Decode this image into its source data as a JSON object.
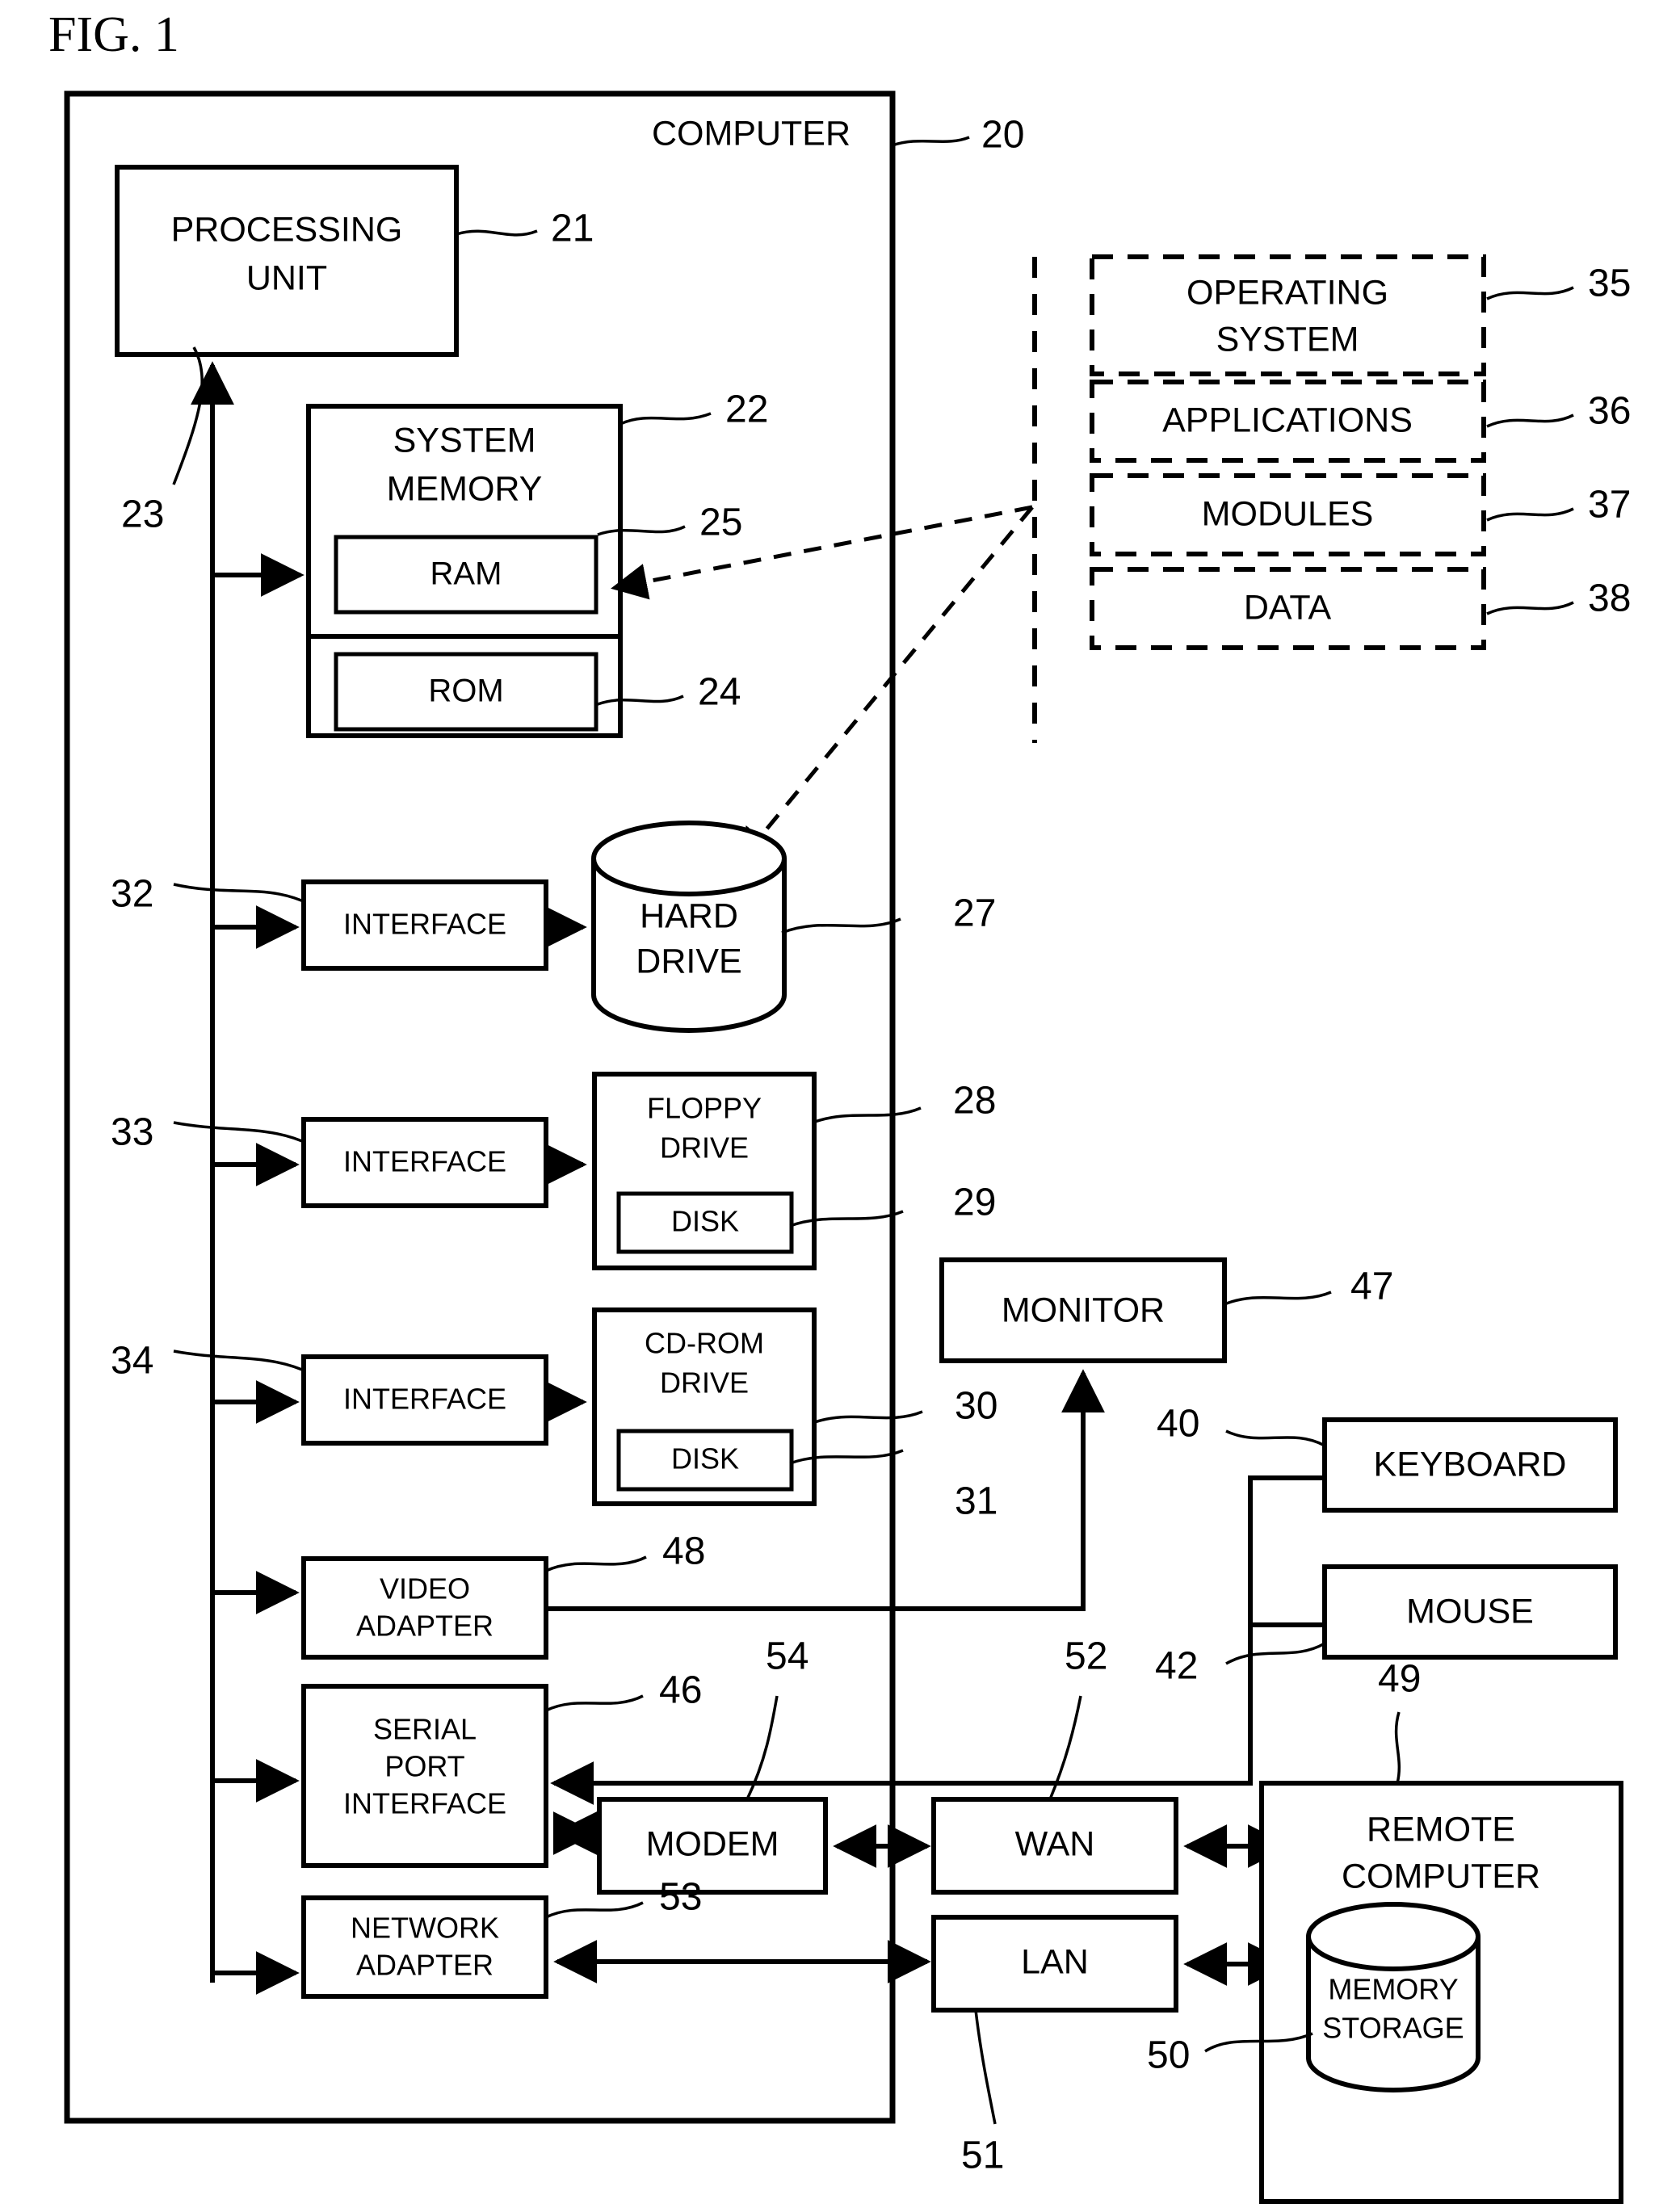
{
  "figure": {
    "title": "FIG. 1",
    "type": "patent-block-diagram"
  },
  "outer": {
    "computer_label": "COMPUTER",
    "computer_ref": "20"
  },
  "blocks": {
    "processing_unit": {
      "line1": "PROCESSING",
      "line2": "UNIT",
      "ref": "21"
    },
    "system_memory": {
      "line1": "SYSTEM",
      "line2": "MEMORY",
      "ref": "22"
    },
    "ram": {
      "label": "RAM",
      "ref": "25"
    },
    "rom": {
      "label": "ROM",
      "ref": "24"
    },
    "bus": {
      "ref": "23"
    },
    "interface_hdd": {
      "label": "INTERFACE",
      "ref": "32"
    },
    "interface_fdd": {
      "label": "INTERFACE",
      "ref": "33"
    },
    "interface_cdrom": {
      "label": "INTERFACE",
      "ref": "34"
    },
    "hard_drive": {
      "line1": "HARD",
      "line2": "DRIVE",
      "ref": "27"
    },
    "floppy_drive": {
      "line1": "FLOPPY",
      "line2": "DRIVE",
      "ref": "28"
    },
    "floppy_disk": {
      "label": "DISK",
      "ref": "29"
    },
    "cdrom_drive": {
      "line1": "CD-ROM",
      "line2": "DRIVE",
      "ref": "30"
    },
    "cdrom_disk": {
      "label": "DISK",
      "ref": "31"
    },
    "video_adapter": {
      "line1": "VIDEO",
      "line2": "ADAPTER",
      "ref": "48"
    },
    "serial_port": {
      "line1": "SERIAL",
      "line2": "PORT",
      "line3": "INTERFACE",
      "ref": "46"
    },
    "network_adapter": {
      "line1": "NETWORK",
      "line2": "ADAPTER",
      "ref": "53"
    },
    "monitor": {
      "label": "MONITOR",
      "ref": "47"
    },
    "keyboard": {
      "label": "KEYBOARD",
      "ref": "40"
    },
    "mouse": {
      "label": "MOUSE",
      "ref": "42"
    },
    "modem": {
      "label": "MODEM",
      "ref": "54"
    },
    "wan": {
      "label": "WAN",
      "ref": "52"
    },
    "lan": {
      "label": "LAN",
      "ref": "51"
    },
    "remote_computer": {
      "line1": "REMOTE",
      "line2": "COMPUTER",
      "ref": "49"
    },
    "memory_storage": {
      "line1": "MEMORY",
      "line2": "STORAGE",
      "ref": "50"
    }
  },
  "memory_contents": {
    "operating_system": {
      "line1": "OPERATING",
      "line2": "SYSTEM",
      "ref": "35"
    },
    "applications": {
      "label": "APPLICATIONS",
      "ref": "36"
    },
    "modules": {
      "label": "MODULES",
      "ref": "37"
    },
    "data": {
      "label": "DATA",
      "ref": "38"
    }
  },
  "colors": {
    "ink": "#000000",
    "paper": "#ffffff"
  }
}
